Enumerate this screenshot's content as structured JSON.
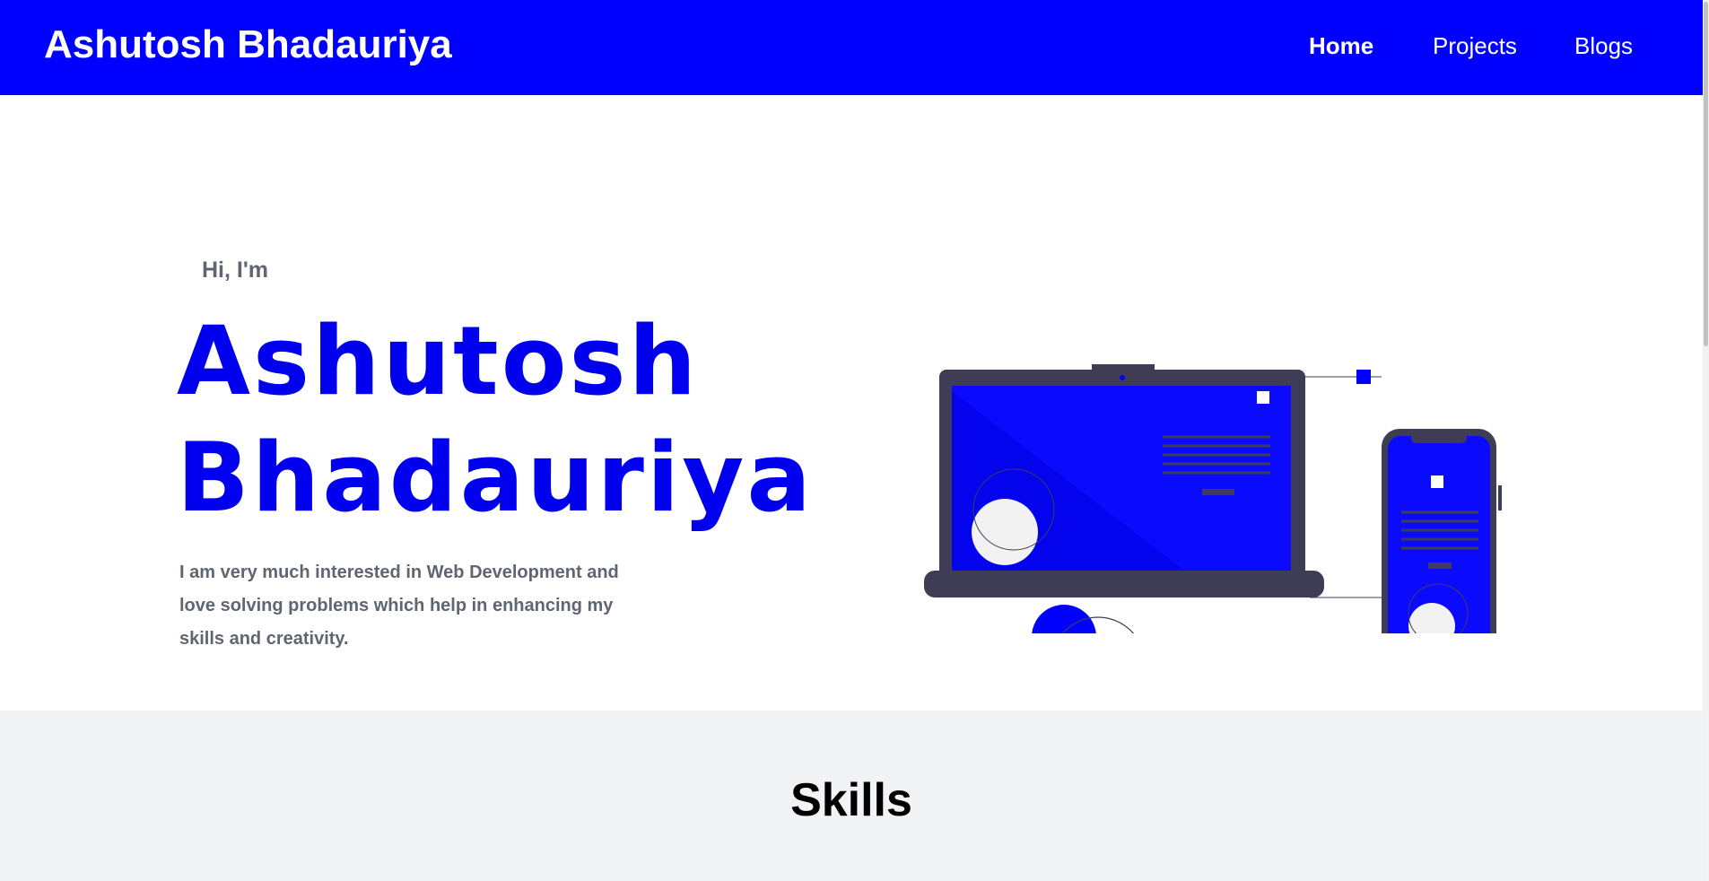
{
  "navbar": {
    "brand": "Ashutosh Bhadauriya",
    "links": [
      {
        "label": "Home",
        "active": true
      },
      {
        "label": "Projects",
        "active": false
      },
      {
        "label": "Blogs",
        "active": false
      }
    ],
    "background": "#0000ff"
  },
  "hero": {
    "greeting": "Hi, I'm",
    "name_line1": "Ashutosh",
    "name_line2": "Bhadauriya",
    "description": "I am very much interested in Web Development and love solving problems which help in enhancing my skills and creativity.",
    "illustration_icon": "laptop-and-phone-illustration",
    "accent": "#0000ee"
  },
  "skills": {
    "title": "Skills",
    "background": "#f2f3f5"
  }
}
